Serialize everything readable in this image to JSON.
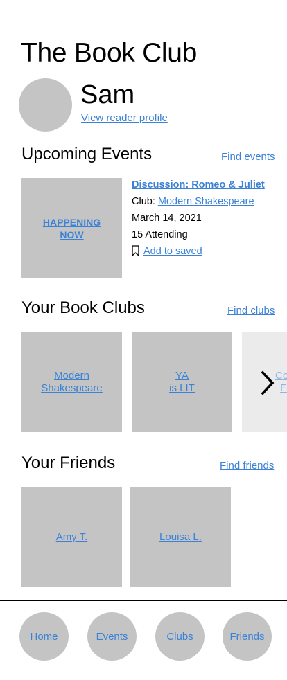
{
  "header": {
    "title": "The Book Club"
  },
  "user": {
    "name": "Sam",
    "profile_link": "View reader profile"
  },
  "events": {
    "heading": "Upcoming Events",
    "find_link": "Find events",
    "featured": {
      "badge_line1": "HAPPENING",
      "badge_line2": "NOW",
      "title": "Discussion: Romeo & Juliet",
      "club_label": "Club:",
      "club_name": "Modern Shakespeare",
      "date": "March 14, 2021",
      "attending": "15 Attending",
      "save_label": "Add to saved"
    }
  },
  "clubs": {
    "heading": "Your Book Clubs",
    "find_link": "Find clubs",
    "items": [
      {
        "line1": "Modern",
        "line2": "Shakespeare"
      },
      {
        "line1": "YA",
        "line2": "is LIT"
      },
      {
        "line1": "Conte",
        "line2": "Fan"
      }
    ],
    "next_icon": "chevron-right-icon"
  },
  "friends": {
    "heading": "Your Friends",
    "find_link": "Find friends",
    "items": [
      {
        "name": "Amy T."
      },
      {
        "name": "Louisa L."
      }
    ]
  },
  "nav": {
    "items": [
      {
        "label": "Home"
      },
      {
        "label": "Events"
      },
      {
        "label": "Clubs"
      },
      {
        "label": "Friends"
      }
    ]
  },
  "colors": {
    "link": "#3b82d6",
    "placeholder": "#c4c4c4",
    "faded": "#ebebeb"
  }
}
